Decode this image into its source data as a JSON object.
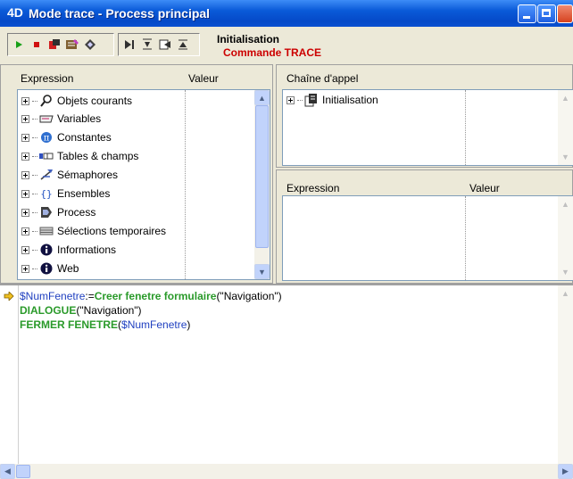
{
  "window": {
    "logo": "4D",
    "title": "Mode trace - Process principal"
  },
  "toolbar": {
    "buttons": [
      "play-icon",
      "stop-icon",
      "abort-icon",
      "edit-icon",
      "debug-icon",
      "step-over-icon",
      "step-into-icon",
      "step-out-icon",
      "step-end-icon"
    ]
  },
  "context": {
    "method": "Initialisation",
    "command": "Commande TRACE"
  },
  "watch_panel": {
    "col_expression": "Expression",
    "col_value": "Valeur",
    "items": [
      {
        "label": "Objets courants",
        "icon": "magnifier-icon"
      },
      {
        "label": "Variables",
        "icon": "variable-icon"
      },
      {
        "label": "Constantes",
        "icon": "pi-icon"
      },
      {
        "label": "Tables & champs",
        "icon": "table-icon"
      },
      {
        "label": "Sémaphores",
        "icon": "semaphore-icon"
      },
      {
        "label": "Ensembles",
        "icon": "set-icon"
      },
      {
        "label": "Process",
        "icon": "process-icon"
      },
      {
        "label": "Sélections temporaires",
        "icon": "selection-icon"
      },
      {
        "label": "Informations",
        "icon": "info-icon"
      },
      {
        "label": "Web",
        "icon": "info-icon"
      }
    ]
  },
  "callchain_panel": {
    "title": "Chaîne d'appel",
    "items": [
      {
        "label": "Initialisation",
        "icon": "method-icon"
      }
    ]
  },
  "custom_watch_panel": {
    "col_expression": "Expression",
    "col_value": "Valeur"
  },
  "code": {
    "line1": {
      "var": "$NumFenetre",
      "op": ":=",
      "cmd": "Creer fenetre formulaire",
      "args": "(\"Navigation\")"
    },
    "line2": {
      "cmd": "DIALOGUE",
      "args": "(\"Navigation\")"
    },
    "line3": {
      "cmd": "FERMER FENETRE",
      "open": "(",
      "var": "$NumFenetre",
      "close": ")"
    }
  },
  "colors": {
    "titlebar": "#0a5ad8",
    "command_red": "#cc0000",
    "code_command": "#2a9a2a",
    "code_variable": "#2040c0"
  }
}
